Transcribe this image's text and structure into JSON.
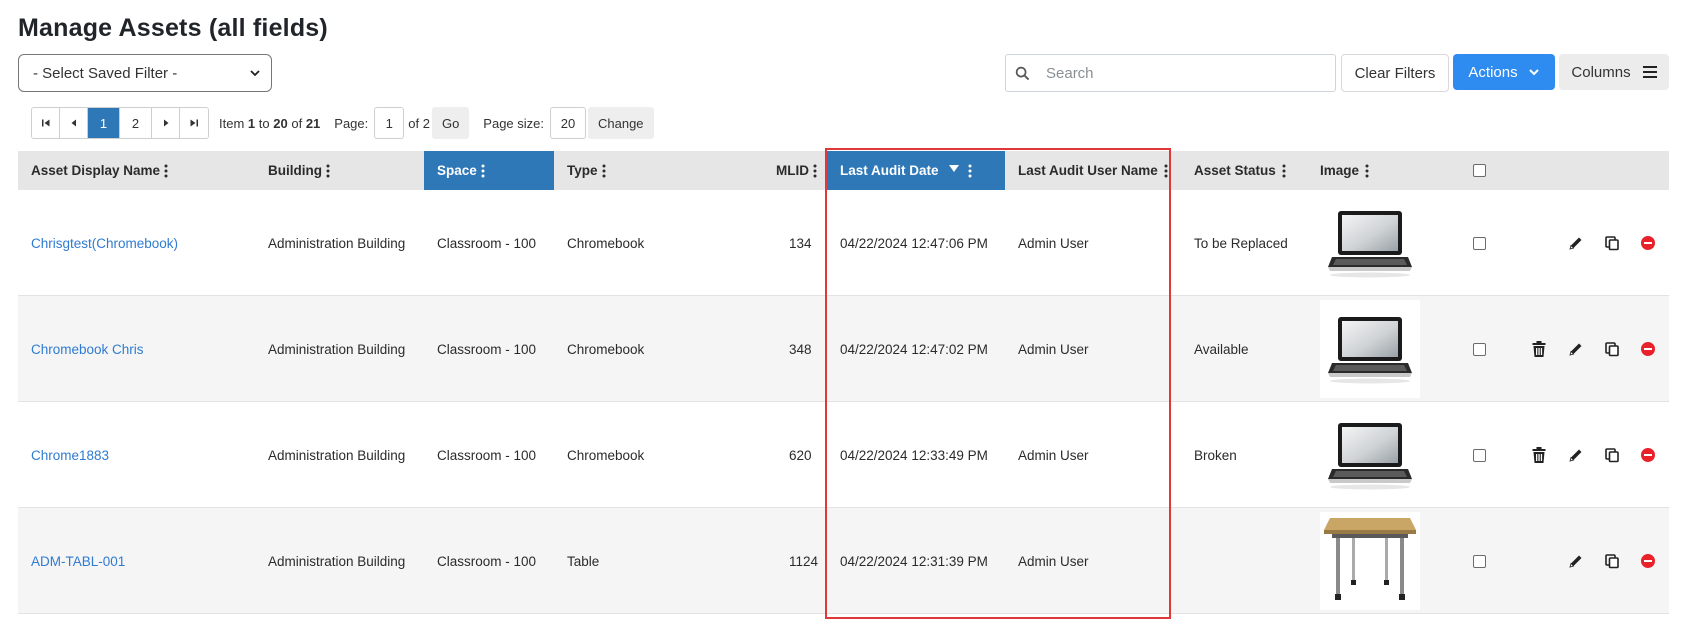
{
  "page": {
    "title": "Manage Assets (all fields)"
  },
  "toolbar": {
    "saved_filter": "- Select Saved Filter -",
    "search_placeholder": "Search",
    "clear_filters": "Clear Filters",
    "actions": "Actions",
    "columns": "Columns"
  },
  "pager": {
    "first": "first-page-icon",
    "prev": "prev-page-icon",
    "pages": [
      "1",
      "2"
    ],
    "next": "next-page-icon",
    "last": "last-page-icon",
    "item_label": "Item",
    "item_start": "1",
    "to_label": "to",
    "item_end": "20",
    "of_label": "of",
    "item_total": "21",
    "page_label": "Page:",
    "page_value": "1",
    "page_of": "of 2",
    "go": "Go",
    "page_size_label": "Page size:",
    "page_size_value": "20",
    "change": "Change"
  },
  "columns": [
    {
      "label": "Asset Display Name"
    },
    {
      "label": "Building"
    },
    {
      "label": "Space"
    },
    {
      "label": "Type"
    },
    {
      "label": "MLID"
    },
    {
      "label": "Last Audit Date"
    },
    {
      "label": "Last Audit User Name"
    },
    {
      "label": "Asset Status"
    },
    {
      "label": "Image"
    }
  ],
  "rows": [
    {
      "name": "Chrisgtest(Chromebook)",
      "building": "Administration Building",
      "space": "Classroom - 100",
      "type": "Chromebook",
      "mlid": "134",
      "audit_date": "04/22/2024 12:47:06 PM",
      "audit_user": "Admin User",
      "status": "To be Replaced",
      "image": "laptop",
      "has_delete": false
    },
    {
      "name": "Chromebook Chris",
      "building": "Administration Building",
      "space": "Classroom - 100",
      "type": "Chromebook",
      "mlid": "348",
      "audit_date": "04/22/2024 12:47:02 PM",
      "audit_user": "Admin User",
      "status": "Available",
      "image": "laptop",
      "has_delete": true
    },
    {
      "name": "Chrome1883",
      "building": "Administration Building",
      "space": "Classroom - 100",
      "type": "Chromebook",
      "mlid": "620",
      "audit_date": "04/22/2024 12:33:49 PM",
      "audit_user": "Admin User",
      "status": "Broken",
      "image": "laptop",
      "has_delete": true
    },
    {
      "name": "ADM-TABL-001",
      "building": "Administration Building",
      "space": "Classroom - 100",
      "type": "Table",
      "mlid": "1124",
      "audit_date": "04/22/2024 12:31:39 PM",
      "audit_user": "Admin User",
      "status": "",
      "image": "table",
      "has_delete": false
    }
  ],
  "colors": {
    "accent": "#2e8bef",
    "active_column": "#2e78b7",
    "link": "#2f7bd1",
    "highlight": "#e0373a"
  }
}
